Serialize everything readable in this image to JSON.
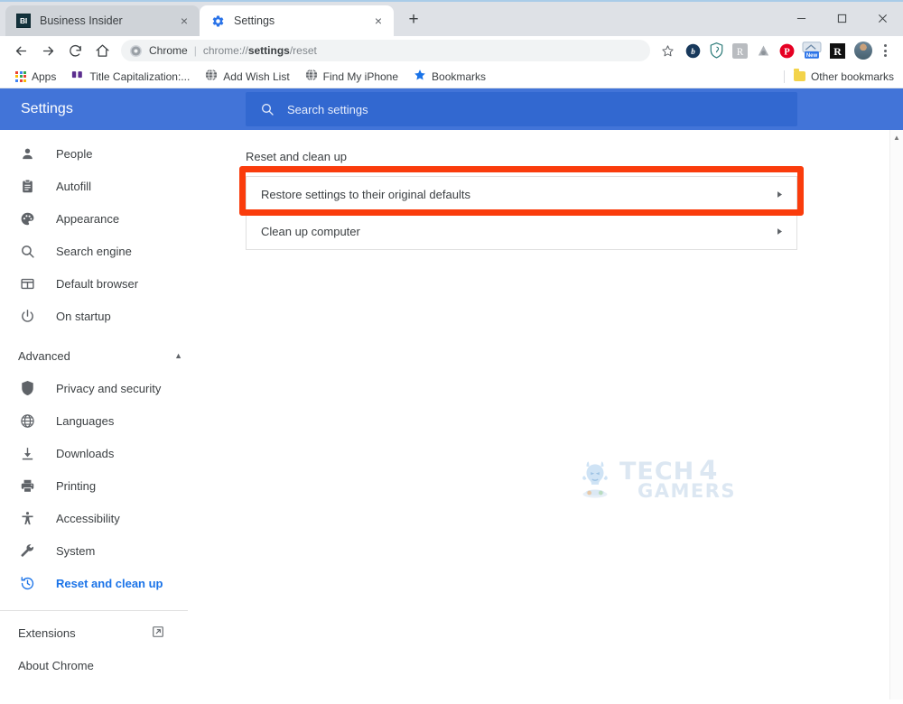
{
  "browser": {
    "tabs": [
      {
        "title": "Business Insider",
        "favicon": "bi-favicon",
        "active": false,
        "close_label": "×"
      },
      {
        "title": "Settings",
        "favicon": "gear-icon",
        "active": true,
        "close_label": "×"
      }
    ],
    "new_tab_label": "+",
    "window_controls": {
      "minimize": "–",
      "maximize": "□",
      "close": "✕"
    },
    "toolbar": {
      "back_label": "←",
      "forward_label": "→",
      "reload_label": "↻",
      "home_label": "⌂",
      "omnibox": {
        "site_label": "Chrome",
        "separator": "|",
        "url_prefix": "chrome://",
        "url_bold": "settings",
        "url_suffix": "/reset"
      },
      "bookmark_star": "☆",
      "extensions": [
        {
          "name": "bitly-extension",
          "glyph": "b"
        },
        {
          "name": "shield-extension",
          "glyph": ""
        },
        {
          "name": "r-gray-extension",
          "glyph": "R"
        },
        {
          "name": "drop-extension",
          "glyph": ""
        },
        {
          "name": "pinterest-extension",
          "glyph": "P"
        },
        {
          "name": "new-badge-extension",
          "glyph": "New"
        },
        {
          "name": "r-black-extension",
          "glyph": "R"
        }
      ],
      "profile_name": "profile-avatar",
      "menu_label": "⋮"
    },
    "bookmarks_bar": {
      "items": [
        {
          "label": "Apps",
          "icon": "apps-grid-icon"
        },
        {
          "label": "Title Capitalization:...",
          "icon": "quote-icon"
        },
        {
          "label": "Add Wish List",
          "icon": "globe-icon"
        },
        {
          "label": "Find My iPhone",
          "icon": "globe-icon"
        },
        {
          "label": "Bookmarks",
          "icon": "star-icon"
        }
      ],
      "other": {
        "label": "Other bookmarks",
        "icon": "folder-icon"
      }
    }
  },
  "settings": {
    "header": {
      "title": "Settings",
      "search_placeholder": "Search settings",
      "search_icon": "search-icon",
      "bg_color": "#4274d8"
    },
    "sidebar": {
      "items": [
        {
          "label": "People",
          "icon": "person-icon",
          "active": false
        },
        {
          "label": "Autofill",
          "icon": "clipboard-icon",
          "active": false
        },
        {
          "label": "Appearance",
          "icon": "palette-icon",
          "active": false
        },
        {
          "label": "Search engine",
          "icon": "search-icon",
          "active": false
        },
        {
          "label": "Default browser",
          "icon": "window-icon",
          "active": false
        },
        {
          "label": "On startup",
          "icon": "power-icon",
          "active": false
        }
      ],
      "advanced": {
        "label": "Advanced",
        "expanded": true,
        "arrow": "▲"
      },
      "advanced_items": [
        {
          "label": "Privacy and security",
          "icon": "shield-icon",
          "active": false
        },
        {
          "label": "Languages",
          "icon": "globe-icon",
          "active": false
        },
        {
          "label": "Downloads",
          "icon": "download-icon",
          "active": false
        },
        {
          "label": "Printing",
          "icon": "printer-icon",
          "active": false
        },
        {
          "label": "Accessibility",
          "icon": "accessibility-icon",
          "active": false
        },
        {
          "label": "System",
          "icon": "wrench-icon",
          "active": false
        },
        {
          "label": "Reset and clean up",
          "icon": "history-icon",
          "active": true
        }
      ],
      "bottom_items": [
        {
          "label": "Extensions",
          "icon": "external-link-icon"
        },
        {
          "label": "About Chrome",
          "icon": ""
        }
      ],
      "active_color": "#1a73e8"
    },
    "main": {
      "section_title": "Reset and clean up",
      "rows": [
        {
          "label": "Restore settings to their original defaults",
          "chevron": "▸",
          "highlighted": true
        },
        {
          "label": "Clean up computer",
          "chevron": "▸",
          "highlighted": false
        }
      ],
      "highlight_color": "#fa3c0c"
    },
    "watermark": {
      "line1a": "TECH",
      "line1b": "4",
      "line2": "GAMERS",
      "color": "#dce7f2"
    },
    "scrollbar": {
      "up_arrow": "▲",
      "down_arrow": "▼"
    }
  }
}
